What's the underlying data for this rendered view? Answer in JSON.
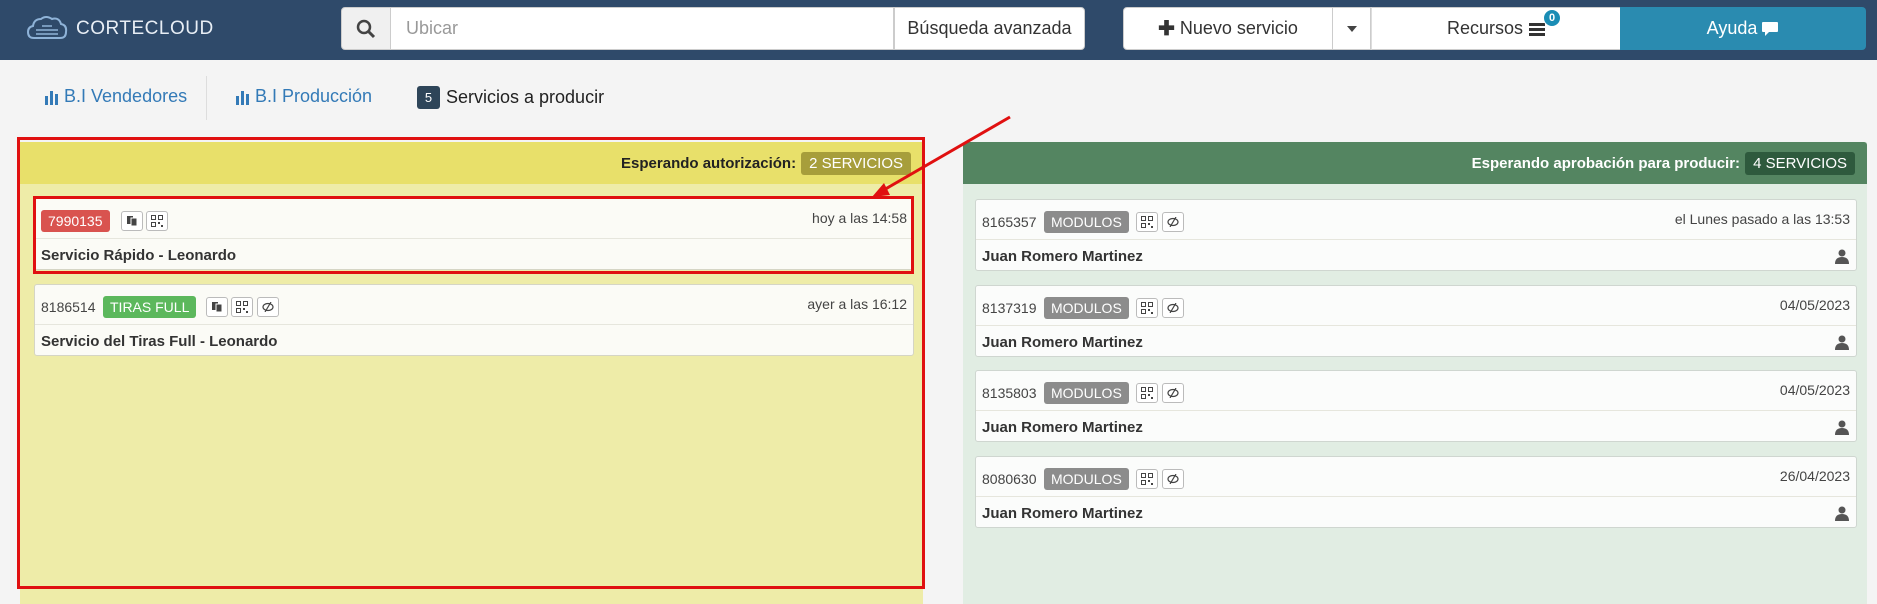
{
  "app": {
    "logo_text": "CORTECLOUD"
  },
  "header": {
    "search_placeholder": "Ubicar",
    "advanced_search_label": "Búsqueda avanzada",
    "new_service_label": "Nuevo servicio",
    "resources_label": "Recursos",
    "resources_badge": "0",
    "help_label": "Ayuda"
  },
  "tabs": [
    {
      "label": "B.I Vendedores"
    },
    {
      "label": "B.I Producción"
    },
    {
      "count": "5",
      "label": "Servicios a producir"
    }
  ],
  "left_column": {
    "header_label": "Esperando autorización:",
    "count_label": "2 SERVICIOS",
    "cards": [
      {
        "id": "7990135",
        "tag": "",
        "time": "hoy a las 14:58",
        "title": "Servicio Rápido - Leonardo"
      },
      {
        "id": "8186514",
        "tag": "TIRAS FULL",
        "time": "ayer a las 16:12",
        "title": "Servicio del Tiras Full - Leonardo"
      }
    ]
  },
  "right_column": {
    "header_label": "Esperando aprobación para producir:",
    "count_label": "4 SERVICIOS",
    "cards": [
      {
        "id": "8165357",
        "tag": "MODULOS",
        "time": "el Lunes pasado a las 13:53",
        "title": "Juan Romero Martinez"
      },
      {
        "id": "8137319",
        "tag": "MODULOS",
        "time": "04/05/2023",
        "title": "Juan Romero Martinez"
      },
      {
        "id": "8135803",
        "tag": "MODULOS",
        "time": "04/05/2023",
        "title": "Juan Romero Martinez"
      },
      {
        "id": "8080630",
        "tag": "MODULOS",
        "time": "26/04/2023",
        "title": "Juan Romero Martinez"
      }
    ]
  },
  "colors": {
    "navbar": "#2f4a6a",
    "help_button": "#2a8bb0",
    "left_header": "#e8e06a",
    "right_header": "#548561",
    "annotation_red": "#e01010"
  }
}
